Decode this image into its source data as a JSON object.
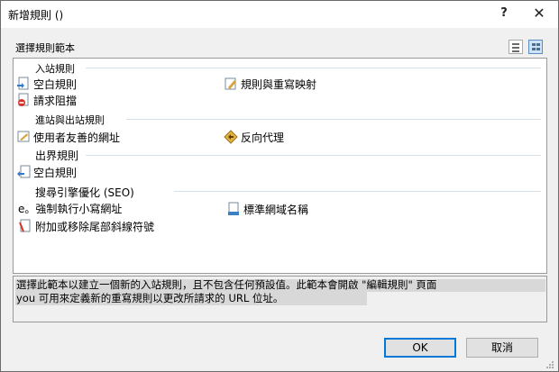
{
  "dialog": {
    "title": "新增規則 ()",
    "help_label": "?",
    "close_label": "✕"
  },
  "section_label": "選擇規則範本",
  "groups": [
    {
      "header": "入站規則",
      "items": [
        {
          "label": "空白規則",
          "icon": "blank-rule-inbound-icon"
        },
        {
          "label": "規則與重寫映射",
          "icon": "rule-rewrite-map-icon"
        },
        {
          "label": "請求阻擋",
          "icon": "request-blocking-icon"
        }
      ]
    },
    {
      "header": "進站與出站規則",
      "items": [
        {
          "label": "使用者友善的網址",
          "icon": "user-friendly-url-icon"
        },
        {
          "label": "反向代理",
          "icon": "reverse-proxy-icon"
        }
      ]
    },
    {
      "header": "出界規則",
      "items": [
        {
          "label": "空白規則",
          "icon": "blank-rule-outbound-icon"
        }
      ]
    },
    {
      "header": "搜尋引擎優化 (SEO)",
      "items": [
        {
          "label": "e。強制執行小寫網址",
          "icon": ""
        },
        {
          "label": "標準網域名稱",
          "icon": "canonical-domain-icon"
        },
        {
          "label": "附加或移除尾部斜線符號",
          "icon": "trailing-slash-icon"
        }
      ]
    }
  ],
  "description": {
    "line1": "選擇此範本以建立一個新的入站規則，且不包含任何預設值。此範本會開啟 \"編輯規則\" 頁面",
    "line2": "you 可用來定義新的重寫規則以更改所請求的 URL 位址。"
  },
  "buttons": {
    "ok": "OK",
    "cancel": "取消"
  }
}
